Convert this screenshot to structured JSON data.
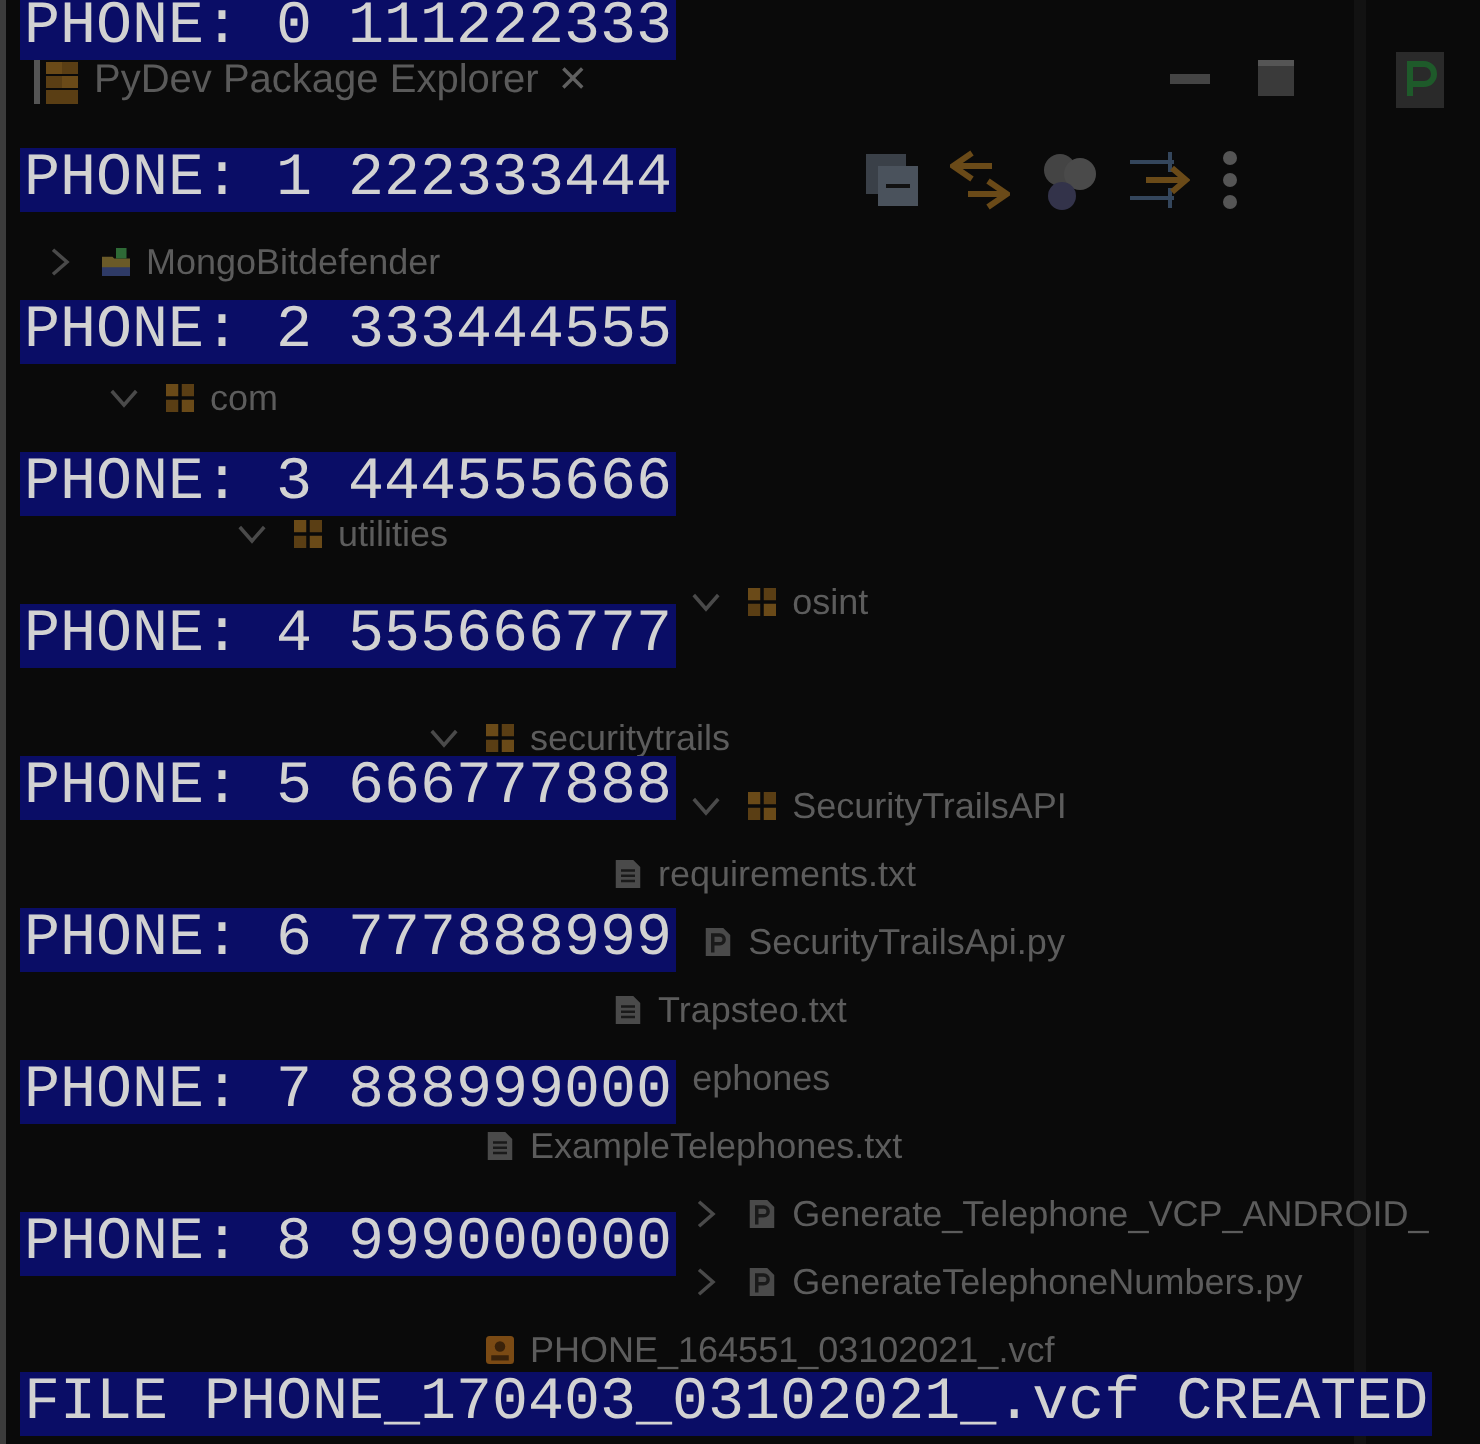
{
  "explorer": {
    "title": "PyDev Package Explorer",
    "close": "×",
    "tree": [
      {
        "label": "MongoBitdefender",
        "kind": "project",
        "expanded": false
      },
      {
        "children": [
          {
            "label": "com",
            "kind": "package",
            "expanded": true,
            "children": [
              {
                "children": [
                  {
                    "label": "utilities",
                    "kind": "package",
                    "expanded": true,
                    "children": [
                      {
                        "label": "osint",
                        "kind": "package",
                        "expanded": true,
                        "children": [
                          {
                            "children": [
                              {
                                "label": "securitytrails",
                                "kind": "package",
                                "expanded": true,
                                "children": [
                                  {
                                    "label": "SecurityTrailsAPI",
                                    "kind": "package",
                                    "expanded": true,
                                    "children": [
                                      {
                                        "label": "requirements.txt",
                                        "kind": "text_file"
                                      },
                                      {
                                        "label": "SecurityTrailsApi.py",
                                        "kind": "python_file"
                                      },
                                      {
                                        "label": "Trapsteo.txt",
                                        "kind": "text_file"
                                      }
                                    ]
                                  }
                                ]
                              }
                            ]
                          },
                          {
                            "label": "ephones",
                            "children": [
                              {
                                "label": "ExampleTelephones.txt",
                                "kind": "text_file"
                              },
                              {
                                "label": "Generate_Telephone_VCP_ANDROID_",
                                "kind": "python_file",
                                "expanded": false
                              },
                              {
                                "label": "GenerateTelephoneNumbers.py",
                                "kind": "python_file",
                                "expanded": false
                              },
                              {
                                "label": "PHONE_164551_03102021_.vcf",
                                "kind": "vcf_file"
                              }
                            ]
                          }
                        ]
                      }
                    ]
                  }
                ]
              }
            ]
          }
        ]
      }
    ]
  },
  "console_lines": [
    "PHONE: 0 111222333",
    "PHONE: 1 222333444",
    "PHONE: 2 333444555",
    "PHONE: 3 444555666",
    "PHONE: 4 555666777",
    "PHONE: 5 666777888",
    "PHONE: 6 777888999",
    "PHONE: 7 888999000",
    "PHONE: 8 999000000",
    "FILE PHONE_170403_03102021_.vcf CREATED"
  ]
}
